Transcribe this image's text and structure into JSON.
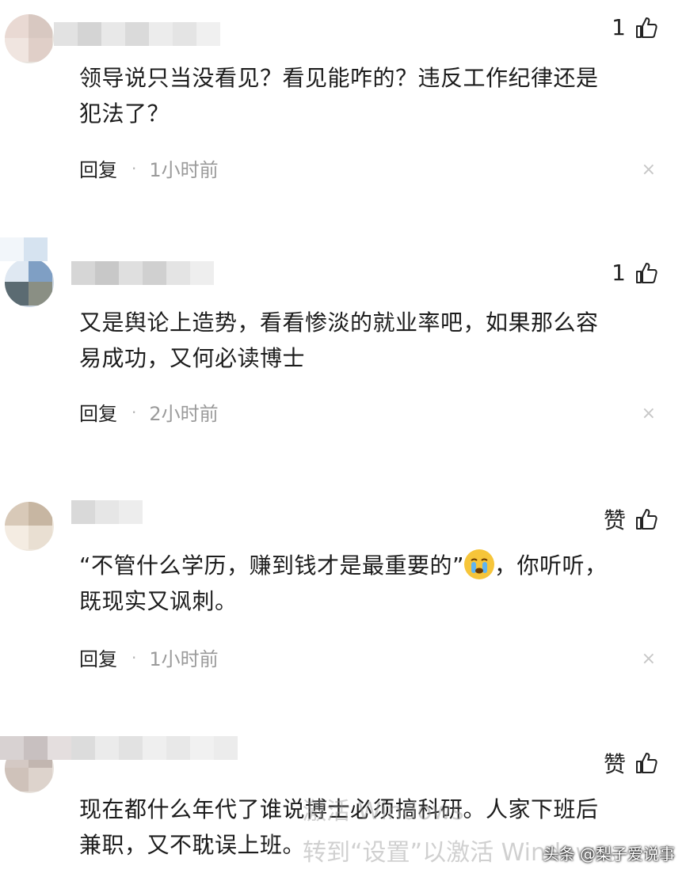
{
  "comments": [
    {
      "likes": "1",
      "text_line1": "领导说只当没看见？看见能咋的？违反工作纪律还是",
      "text_line2": "犯法了？",
      "reply": "回复",
      "time": "1小时前"
    },
    {
      "likes": "1",
      "text_line1": "又是舆论上造势，看看惨淡的就业率吧，如果那么容",
      "text_line2": "易成功，又何必读博士",
      "reply": "回复",
      "time": "2小时前"
    },
    {
      "likes": "赞",
      "text_line1_a": "“不管什么学历，赚到钱才是最重要的”",
      "text_line1_b": "，你听听，",
      "text_line2": "既现实又讽刺。",
      "reply": "回复",
      "time": "1小时前"
    },
    {
      "likes": "赞",
      "text_line1": "现在都什么年代了谁说博士必须搞科研。人家下班后",
      "text_line2": "兼职，又不耽误上班。"
    }
  ],
  "icons": {
    "like": "thumbs-up-icon",
    "close": "close-icon",
    "emoji": "crying-face-emoji"
  },
  "dot_separator": "·",
  "close_glyph": "×",
  "watermark": {
    "line1": "激活 Windows",
    "line2": "转到“设置”以激活 Windows。"
  },
  "brand": "头条 @梨子爱说事",
  "colors": {
    "text": "#1c1c1c",
    "meta": "#9a9a9a",
    "emoji": "#f6c53a"
  }
}
